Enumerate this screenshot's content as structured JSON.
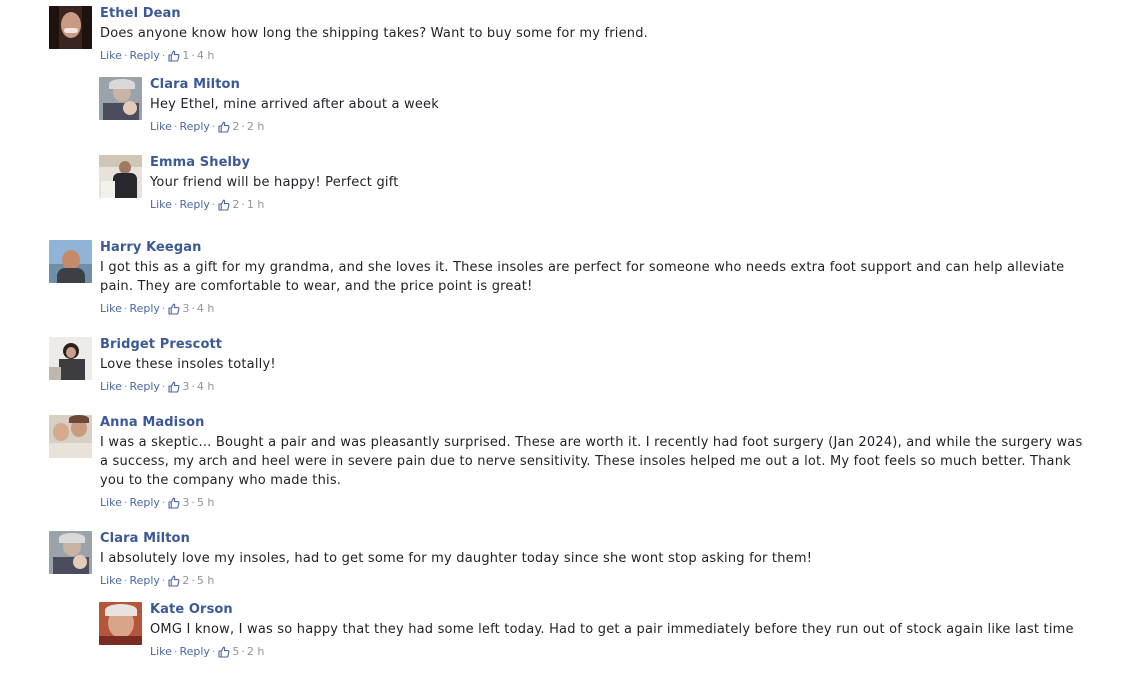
{
  "labels": {
    "like": "Like",
    "reply": "Reply"
  },
  "comments": [
    {
      "name": "Ethel Dean",
      "text": "Does anyone know how long the shipping takes? Want to buy some for my friend.",
      "likes": "1",
      "time": "4 h"
    },
    {
      "name": "Clara Milton",
      "text": "Hey Ethel, mine arrived after about a week",
      "likes": "2",
      "time": "2 h"
    },
    {
      "name": "Emma Shelby",
      "text": "Your friend will be happy! Perfect gift",
      "likes": "2",
      "time": "1 h"
    },
    {
      "name": "Harry Keegan",
      "text": "I got this as a gift for my grandma, and she loves it. These insoles are perfect for someone who needs extra foot support and can help alleviate pain. They are comfortable to wear, and the price point is great!",
      "likes": "3",
      "time": "4 h"
    },
    {
      "name": "Bridget Prescott",
      "text": "Love these insoles totally!",
      "likes": "3",
      "time": "4 h"
    },
    {
      "name": "Anna Madison",
      "text": "I was a skeptic... Bought a pair and was pleasantly surprised. These are worth it. I recently had foot surgery (Jan 2024), and while the surgery was a success, my arch and heel were in severe pain due to nerve sensitivity. These insoles helped me out a lot. My foot feels so much better. Thank you to the company who made this.",
      "likes": "3",
      "time": "5 h"
    },
    {
      "name": "Clara Milton",
      "text": "I absolutely love my insoles, had to get some for my daughter today since she wont stop asking for them!",
      "likes": "2",
      "time": "5 h"
    },
    {
      "name": "Kate Orson",
      "text": "OMG I know, I was so happy that they had some left today. Had to get a pair immediately before they run out of stock again like last time",
      "likes": "5",
      "time": "2 h"
    }
  ]
}
